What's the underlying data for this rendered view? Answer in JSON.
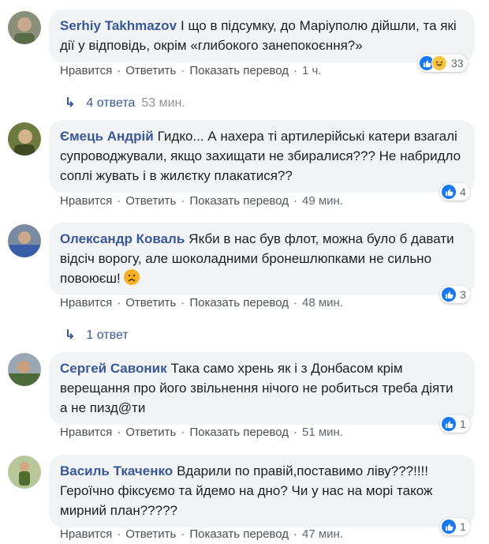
{
  "comments": [
    {
      "author": "Serhiy Takhmazov",
      "text": "І що в підсумку, до Маріуполю дійшли, та які дії у відповідь, окрім «глибокого занепокоєння?»",
      "actions": {
        "like": "Нравится",
        "reply": "Ответить",
        "translate": "Показать перевод",
        "time": "1 ч."
      },
      "reactions": {
        "types": [
          "like-icon",
          "haha-icon"
        ],
        "count": "33"
      },
      "replies": {
        "label": "4 ответа",
        "time": "53 мин."
      }
    },
    {
      "author": "Ємець Андрій",
      "text": "Гидко... А нахера ті артилерійські катери взагалі супроводжували, якщо захищати не збиралися??? Не набридло соплі жувать і в жилєтку плакатися??",
      "actions": {
        "like": "Нравится",
        "reply": "Ответить",
        "translate": "Показать перевод",
        "time": "49 мин."
      },
      "reactions": {
        "types": [
          "like-icon"
        ],
        "count": "4"
      }
    },
    {
      "author": "Олександр Коваль",
      "text": "Якби в нас був флот, можна було б давати відсіч ворогу, але шоколадними бронешлюпками не сильно повоюєш!",
      "emoji": "sad-face-icon",
      "actions": {
        "like": "Нравится",
        "reply": "Ответить",
        "translate": "Показать перевод",
        "time": "48 мин."
      },
      "reactions": {
        "types": [
          "like-icon"
        ],
        "count": "3"
      },
      "replies": {
        "label": "1 ответ",
        "time": ""
      }
    },
    {
      "author": "Сергей Савоник",
      "text": "Така само хрень як і з Донбасом крім верещання про його звільнення нічого не робиться треба діяти а не пизд@ти",
      "actions": {
        "like": "Нравится",
        "reply": "Ответить",
        "translate": "Показать перевод",
        "time": "51 мин."
      },
      "reactions": {
        "types": [
          "like-icon"
        ],
        "count": "1"
      }
    },
    {
      "author": "Василь Ткаченко",
      "text": "Вдарили по правій,поставимо ліву???!!!! Героїчно фіксуємо та йдемо на дно? Чи у нас на морі також мирний план?????",
      "actions": {
        "like": "Нравится",
        "reply": "Ответить",
        "translate": "Показать перевод",
        "time": "47 мин."
      },
      "reactions": {
        "types": [
          "like-icon"
        ],
        "count": "1"
      }
    }
  ],
  "colors": {
    "link": "#385898",
    "bubble": "#f2f3f5",
    "like": "#1877f2"
  }
}
